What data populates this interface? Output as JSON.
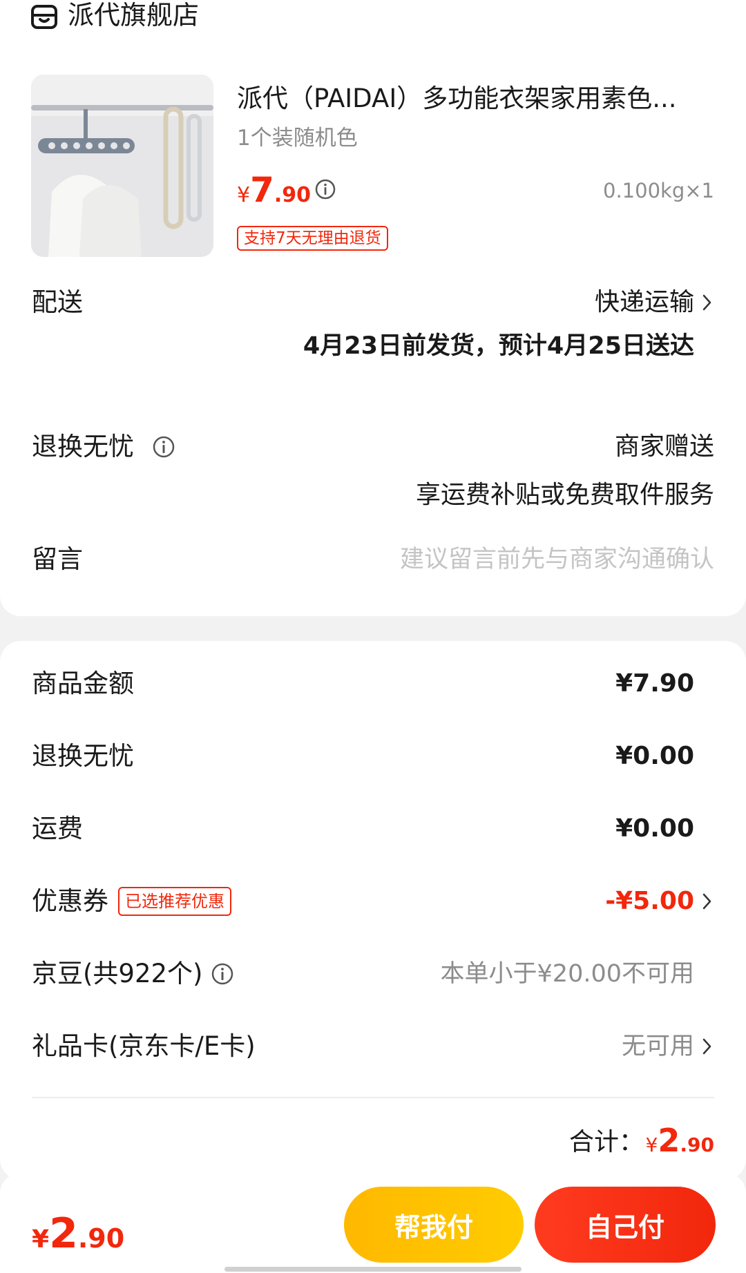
{
  "store": {
    "name": "派代旗舰店",
    "icon": "store-icon"
  },
  "product": {
    "title": "派代（PAIDAI）多功能衣架家用素色...",
    "spec": "1个装随机色",
    "price_symbol": "¥",
    "price_int": "7",
    "price_dec": ".90",
    "weight_qty": "0.100kg×1",
    "return_badge": "支持7天无理由退货"
  },
  "delivery": {
    "label": "配送",
    "method": "快递运输",
    "time": "4月23日前发货，预计4月25日送达"
  },
  "guarantee": {
    "label": "退换无忧",
    "value": "商家赠送",
    "desc": "享运费补贴或免费取件服务"
  },
  "note": {
    "label": "留言",
    "placeholder": "建议留言前先与商家沟通确认",
    "value": ""
  },
  "costs": {
    "goods_label": "商品金额",
    "goods_value": "¥7.90",
    "guarantee_label": "退换无忧",
    "guarantee_value": "¥0.00",
    "shipping_label": "运费",
    "shipping_value": "¥0.00",
    "coupon_label": "优惠券",
    "coupon_badge": "已选推荐优惠",
    "coupon_value": "-¥5.00",
    "beans_label": "京豆(共922个)",
    "beans_value": "本单小于¥20.00不可用",
    "gift_label": "礼品卡(京东卡/E卡)",
    "gift_value": "无可用",
    "total_label": "合计：",
    "total_symbol": "¥",
    "total_int": "2",
    "total_dec": ".90"
  },
  "bottom": {
    "price_symbol": "¥",
    "price_int": "2",
    "price_dec": ".90",
    "help_pay_label": "帮我付",
    "self_pay_label": "自己付"
  },
  "colors": {
    "accent_red": "#f2270c",
    "help_pay_yellow": "#ffc200",
    "muted_text": "#8c8c8c",
    "background": "#f2f2f2"
  }
}
